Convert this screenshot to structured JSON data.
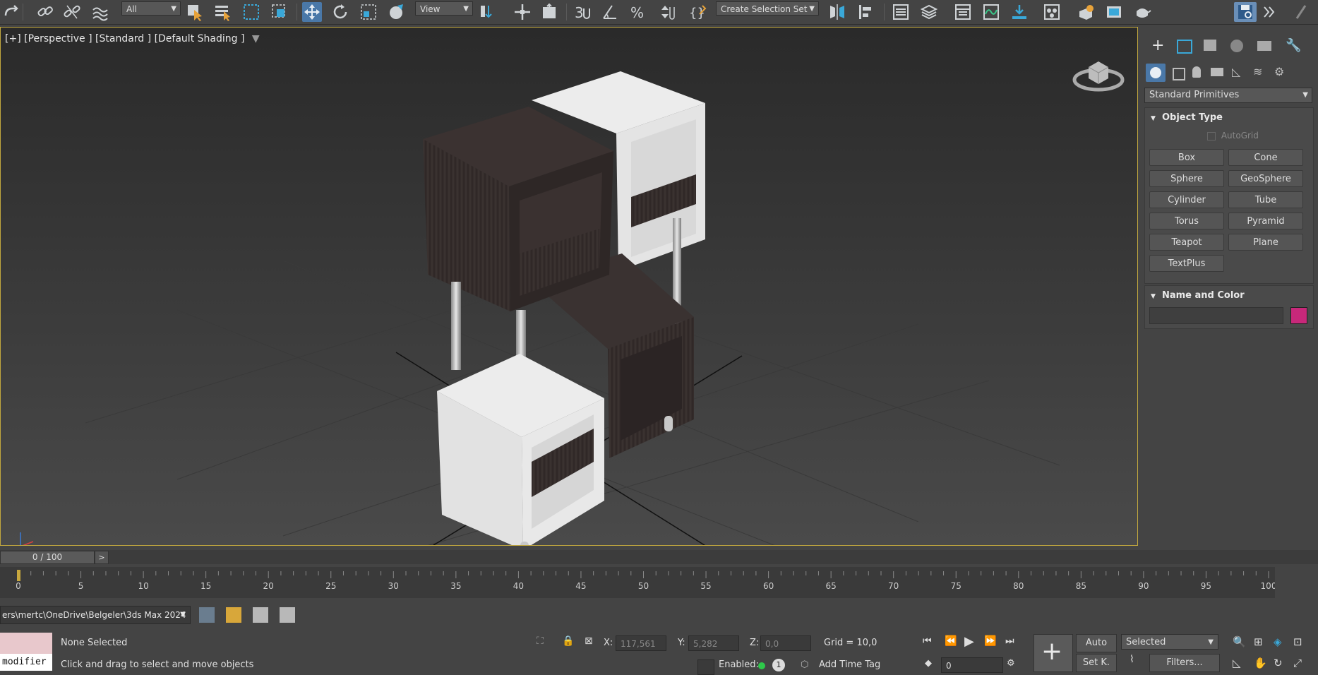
{
  "toolbar": {
    "selection_filter": "All",
    "ref_coord": "View",
    "selection_set": "Create Selection Set"
  },
  "viewport": {
    "label_plus": "[+]",
    "label_view": "[Perspective ]",
    "label_standard": "[Standard ]",
    "label_shading": "[Default Shading ]"
  },
  "command_panel": {
    "category": "Standard Primitives",
    "object_type_title": "Object Type",
    "autogrid_label": "AutoGrid",
    "buttons": [
      "Box",
      "Cone",
      "Sphere",
      "GeoSphere",
      "Cylinder",
      "Tube",
      "Torus",
      "Pyramid",
      "Teapot",
      "Plane",
      "TextPlus"
    ],
    "name_color_title": "Name and Color",
    "object_color": "#c8287a"
  },
  "timeslider": {
    "frame_label": "0 / 100",
    "next_label": ">"
  },
  "timeline": {
    "ticks": [
      "0",
      "5",
      "10",
      "15",
      "20",
      "25",
      "30",
      "35",
      "40",
      "45",
      "50",
      "55",
      "60",
      "65",
      "70",
      "75",
      "80",
      "85",
      "90",
      "95",
      "100"
    ]
  },
  "status": {
    "path": "ers\\mertc\\OneDrive\\Belgeler\\3ds Max 2024",
    "script_text": "modifier",
    "selection_status": "None Selected",
    "prompt": "Click and drag to select and move objects",
    "x_label": "X:",
    "x_value": "117,561",
    "y_label": "Y:",
    "y_value": "5,282",
    "z_label": "Z:",
    "z_value": "0,0",
    "grid": "Grid = 10,0",
    "enabled_label": "Enabled:",
    "enabled_count": "1",
    "add_time_tag": "Add Time Tag",
    "auto_label": "Auto",
    "setkey_label": "Set K.",
    "selected_dropdown": "Selected",
    "filters_label": "Filters...",
    "frame_value": "0"
  }
}
